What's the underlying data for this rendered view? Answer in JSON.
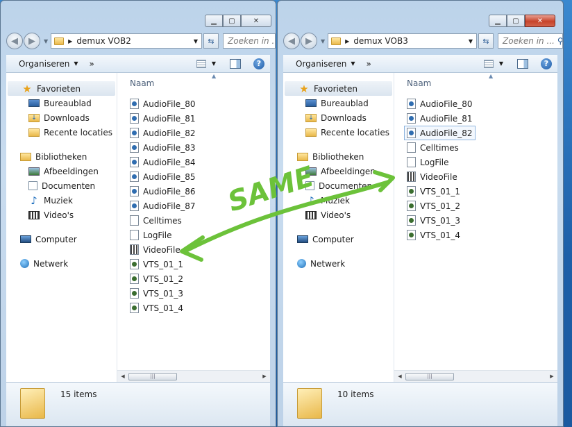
{
  "windows": [
    {
      "address": "demux VOB2",
      "search_placeholder": "Zoeken in ...",
      "toolbar": {
        "organize": "Organiseren",
        "more": "»"
      },
      "column_header": "Naam",
      "nav": {
        "favorites": {
          "label": "Favorieten",
          "items": [
            "Bureaublad",
            "Downloads",
            "Recente locaties"
          ]
        },
        "libraries": {
          "label": "Bibliotheken",
          "items": [
            "Afbeeldingen",
            "Documenten",
            "Muziek",
            "Video's"
          ]
        },
        "computer": "Computer",
        "network": "Netwerk"
      },
      "files": [
        "AudioFile_80",
        "AudioFile_81",
        "AudioFile_82",
        "AudioFile_83",
        "AudioFile_84",
        "AudioFile_85",
        "AudioFile_86",
        "AudioFile_87",
        "Celltimes",
        "LogFile",
        "VideoFile",
        "VTS_01_1",
        "VTS_01_2",
        "VTS_01_3",
        "VTS_01_4"
      ],
      "status": "15 items"
    },
    {
      "address": "demux VOB3",
      "search_placeholder": "Zoeken in ...",
      "toolbar": {
        "organize": "Organiseren",
        "more": "»"
      },
      "column_header": "Naam",
      "nav": {
        "favorites": {
          "label": "Favorieten",
          "items": [
            "Bureaublad",
            "Downloads",
            "Recente locaties"
          ]
        },
        "libraries": {
          "label": "Bibliotheken",
          "items": [
            "Afbeeldingen",
            "Documenten",
            "Muziek",
            "Video's"
          ]
        },
        "computer": "Computer",
        "network": "Netwerk"
      },
      "files": [
        "AudioFile_80",
        "AudioFile_81",
        "AudioFile_82",
        "Celltimes",
        "LogFile",
        "VideoFile",
        "VTS_01_1",
        "VTS_01_2",
        "VTS_01_3",
        "VTS_01_4"
      ],
      "selected_file": "AudioFile_82",
      "status": "10 items"
    }
  ],
  "annotation": {
    "text": "SAME",
    "color": "#6cc23a"
  }
}
